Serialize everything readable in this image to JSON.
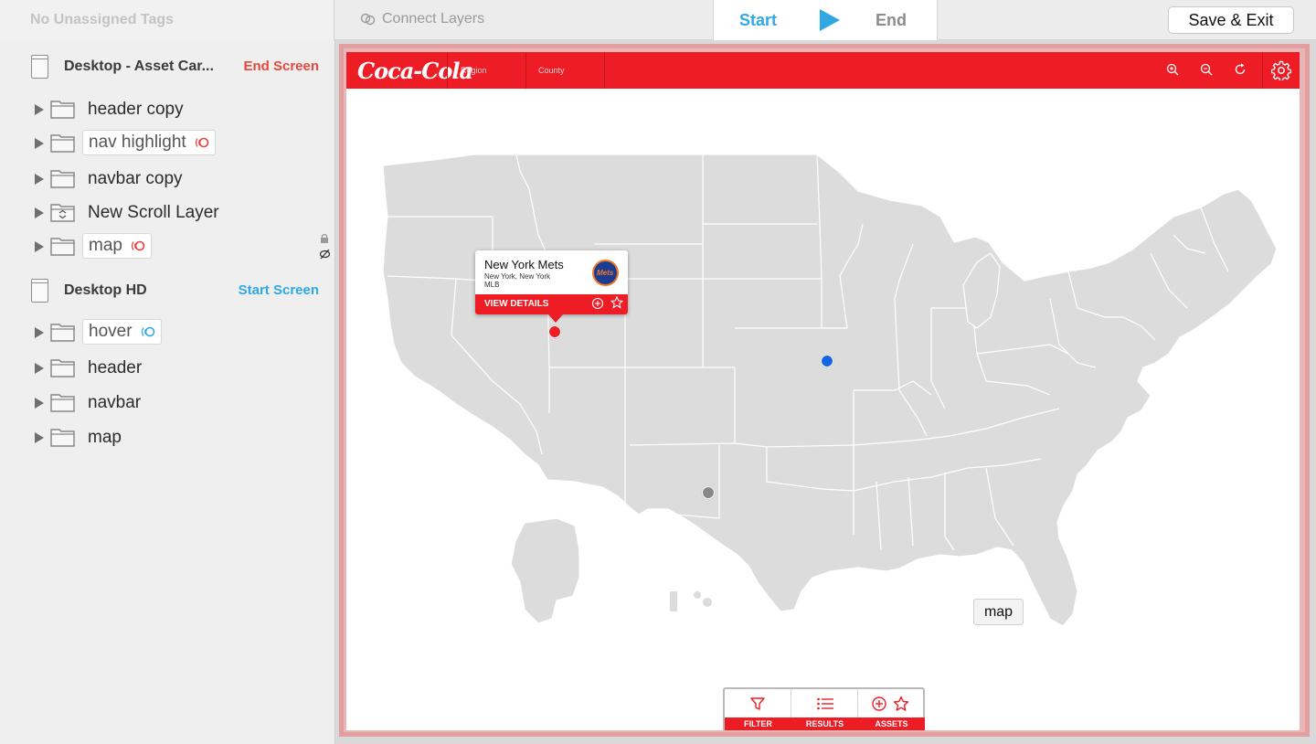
{
  "topbar": {
    "unassigned_tags": "No Unassigned Tags",
    "connect_layers": "Connect Layers",
    "start": "Start",
    "end": "End",
    "save_exit": "Save & Exit"
  },
  "sidebar": {
    "screens": [
      {
        "name": "Desktop - Asset Car...",
        "tag": "End Screen",
        "layers": [
          {
            "label": "header copy",
            "hotspot": false
          },
          {
            "label": "nav highlight",
            "hotspot": true
          },
          {
            "label": "navbar copy",
            "hotspot": false
          },
          {
            "label": "New Scroll Layer",
            "hotspot": false
          },
          {
            "label": "map",
            "hotspot": true
          }
        ]
      },
      {
        "name": "Desktop HD",
        "tag": "Start Screen",
        "layers": [
          {
            "label": "hover",
            "hotspot": true
          },
          {
            "label": "header",
            "hotspot": false
          },
          {
            "label": "navbar",
            "hotspot": false
          },
          {
            "label": "map",
            "hotspot": false
          }
        ]
      }
    ]
  },
  "artboard": {
    "logo": "Coca-Cola",
    "header_tabs": [
      "Region",
      "County"
    ],
    "popup": {
      "title": "New York Mets",
      "subtitle": "New York, New York",
      "league": "MLB",
      "team_logo_text": "Mets",
      "button": "VIEW DETAILS"
    },
    "map_tooltip": "map",
    "toolbar": [
      "FILTER",
      "RESULTS",
      "ASSETS"
    ]
  },
  "colors": {
    "accent_red": "#ee1c25",
    "accent_blue": "#2fa8e3",
    "end_tag_red": "#e6483d",
    "marker_blue": "#1464e6",
    "marker_gray": "#888888",
    "map_fill": "#dcdcdc"
  },
  "icons": {
    "connect": "link-icon",
    "play": "play-icon",
    "folder": "folder-icon",
    "hotspot": "hotspot-icon",
    "zoom_in": "zoom-in-icon",
    "zoom_out": "zoom-out-icon",
    "refresh": "refresh-icon",
    "settings": "gear-icon",
    "filter": "filter-icon",
    "results": "list-icon",
    "assets": "plus-star-icon"
  }
}
